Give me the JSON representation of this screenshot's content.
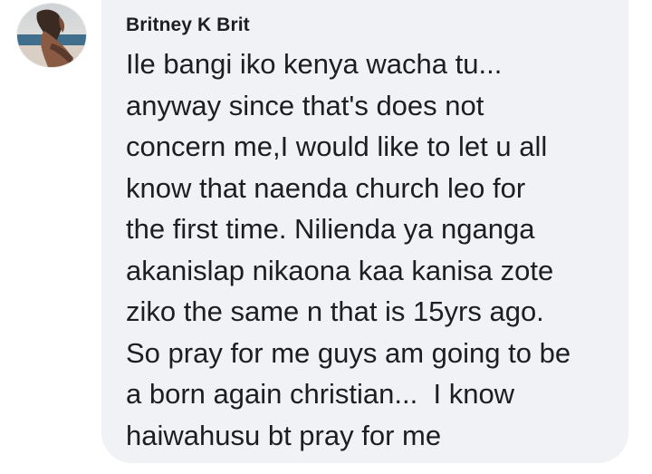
{
  "comment": {
    "author": "Britney K Brit",
    "lines": [
      "Ile bangi iko kenya wacha tu...",
      "anyway since that's does not",
      "concern me,I would like to let u all",
      "know that naenda church leo for",
      "the first time. Nilienda ya nganga",
      "akanislap nikaona kaa kanisa zote",
      "ziko the same n that is 15yrs ago.",
      "So pray for me guys am going to be",
      "a born again christian...  I know",
      "haiwahusu bt pray for me"
    ]
  },
  "colors": {
    "bubble": "#f0f2f5",
    "text": "#1c1e21",
    "background": "#ffffff"
  }
}
